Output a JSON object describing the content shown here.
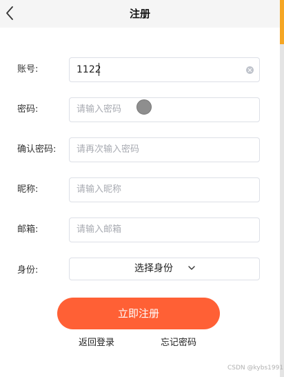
{
  "header": {
    "title": "注册",
    "back_icon": "chevron-left-icon"
  },
  "form": {
    "account": {
      "label": "账号:",
      "value": "1122",
      "clear_icon": "clear-circle-icon"
    },
    "password": {
      "label": "密码:",
      "placeholder": "请输入密码"
    },
    "confirm_password": {
      "label": "确认密码:",
      "placeholder": "请再次输入密码"
    },
    "nickname": {
      "label": "昵称:",
      "placeholder": "请输入昵称"
    },
    "email": {
      "label": "邮箱:",
      "placeholder": "请输入邮箱"
    },
    "identity": {
      "label": "身份:",
      "selected": "选择身份",
      "icon": "chevron-down-icon"
    }
  },
  "actions": {
    "submit_label": "立即注册",
    "back_login_label": "返回登录",
    "forgot_password_label": "忘记密码"
  },
  "watermark": "CSDN @kybs1991",
  "colors": {
    "accent": "#ff6035",
    "edge_accent": "#f5a623",
    "border": "#dcdfe6",
    "placeholder": "#a8abb2"
  }
}
